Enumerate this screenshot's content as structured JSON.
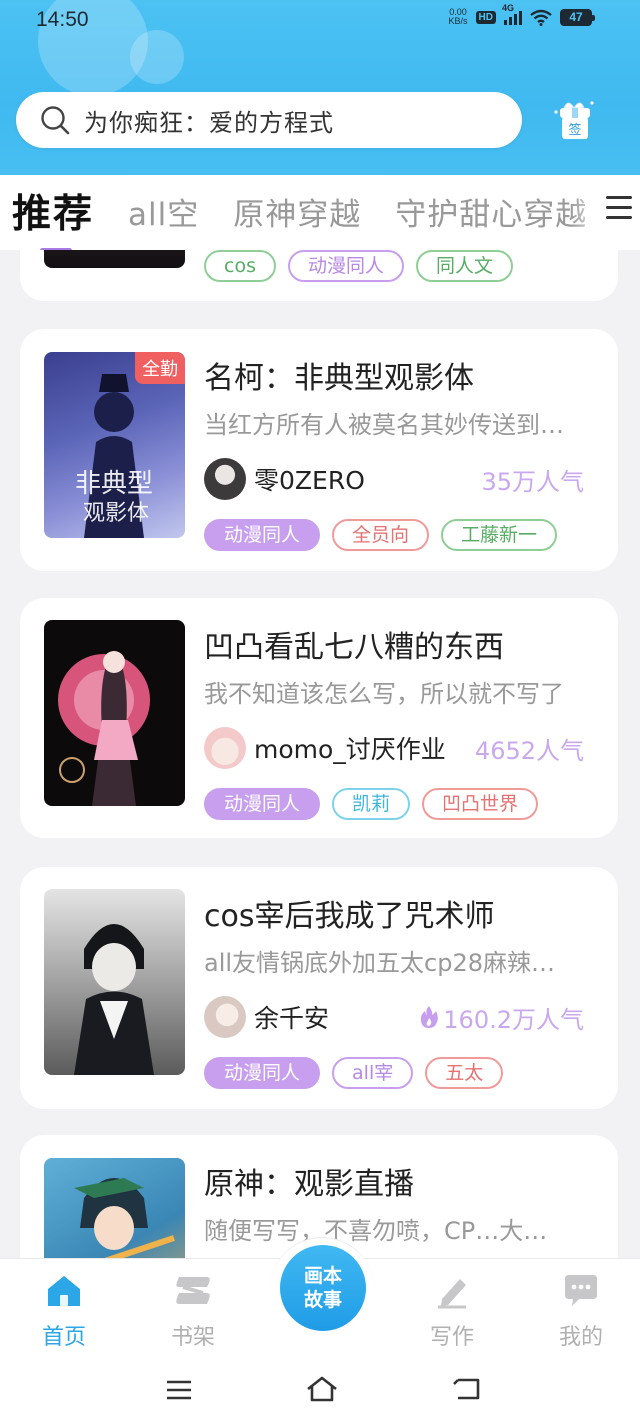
{
  "status_bar": {
    "time": "14:50",
    "net_speed_value": "0.00",
    "net_speed_unit": "KB/s",
    "hd": "HD",
    "network": "4G",
    "battery": "47"
  },
  "search": {
    "placeholder": "为你痴狂：爱的方程式",
    "checkin_label": "签"
  },
  "tabs": [
    "推荐",
    "all空",
    "原神穿越",
    "守护甜心穿越"
  ],
  "partial_card": {
    "tags": [
      "cos",
      "动漫同人",
      "同人文"
    ]
  },
  "books": [
    {
      "title": "名柯：非典型观影体",
      "desc": "当红方所有人被莫名其妙传送到…",
      "author": "零0ZERO",
      "popularity": "35万人气",
      "badge": "全勤",
      "tags": [
        "动漫同人",
        "全员向",
        "工藤新一"
      ]
    },
    {
      "title": "凹凸看乱七八糟的东西",
      "desc": "我不知道该怎么写，所以就不写了",
      "author": "momo_讨厌作业",
      "popularity": "4652人气",
      "tags": [
        "动漫同人",
        "凯莉",
        "凹凸世界"
      ]
    },
    {
      "title": "cos宰后我成了咒术师",
      "desc": "all友情锅底外加五太cp28麻辣…",
      "author": "余千安",
      "popularity": "160.2万人气",
      "tags": [
        "动漫同人",
        "all宰",
        "五太"
      ]
    },
    {
      "title": "原神：观影直播",
      "desc": "随便写写，不喜勿喷，CP…大…"
    }
  ],
  "bottom_nav": {
    "home": "首页",
    "shelf": "书架",
    "center_line1": "画本",
    "center_line2": "故事",
    "write": "写作",
    "mine": "我的"
  },
  "colors": {
    "accent_blue": "#3fb9f0",
    "tag_purple": "#c79fee",
    "popularity": "#c9a8ee",
    "nav_active": "#2ba6e6"
  }
}
